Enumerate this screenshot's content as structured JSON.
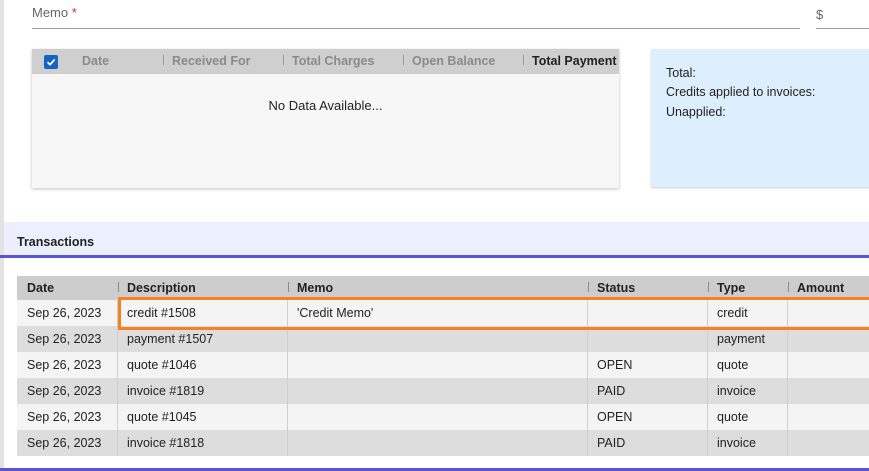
{
  "memo": {
    "label": "Memo",
    "required_mark": "*",
    "currency_symbol": "$"
  },
  "payments_table": {
    "columns": [
      "Date",
      "Received For",
      "Total Charges",
      "Open Balance",
      "Total Payment"
    ],
    "empty_message": "No Data Available...",
    "select_all_checked": true
  },
  "summary": {
    "total_label": "Total:",
    "credits_label": "Credits applied to invoices:",
    "unapplied_label": "Unapplied:"
  },
  "transactions": {
    "title": "Transactions",
    "columns": [
      "Date",
      "Description",
      "Memo",
      "Status",
      "Type",
      "Amount"
    ],
    "rows": [
      {
        "date": "Sep 26, 2023",
        "description": "credit #1508",
        "memo": "'Credit Memo'",
        "status": "",
        "type": "credit",
        "amount": ""
      },
      {
        "date": "Sep 26, 2023",
        "description": "payment #1507",
        "memo": "",
        "status": "",
        "type": "payment",
        "amount": ""
      },
      {
        "date": "Sep 26, 2023",
        "description": "quote #1046",
        "memo": "",
        "status": "OPEN",
        "type": "quote",
        "amount": ""
      },
      {
        "date": "Sep 26, 2023",
        "description": "invoice #1819",
        "memo": "",
        "status": "PAID",
        "type": "invoice",
        "amount": ""
      },
      {
        "date": "Sep 26, 2023",
        "description": "quote #1045",
        "memo": "",
        "status": "OPEN",
        "type": "quote",
        "amount": ""
      },
      {
        "date": "Sep 26, 2023",
        "description": "invoice #1818",
        "memo": "",
        "status": "PAID",
        "type": "invoice",
        "amount": ""
      }
    ]
  },
  "colors": {
    "accent": "#5a55d6",
    "highlight": "#f5821f",
    "checkbox": "#1565c0",
    "summary_bg": "#ddeefc"
  }
}
